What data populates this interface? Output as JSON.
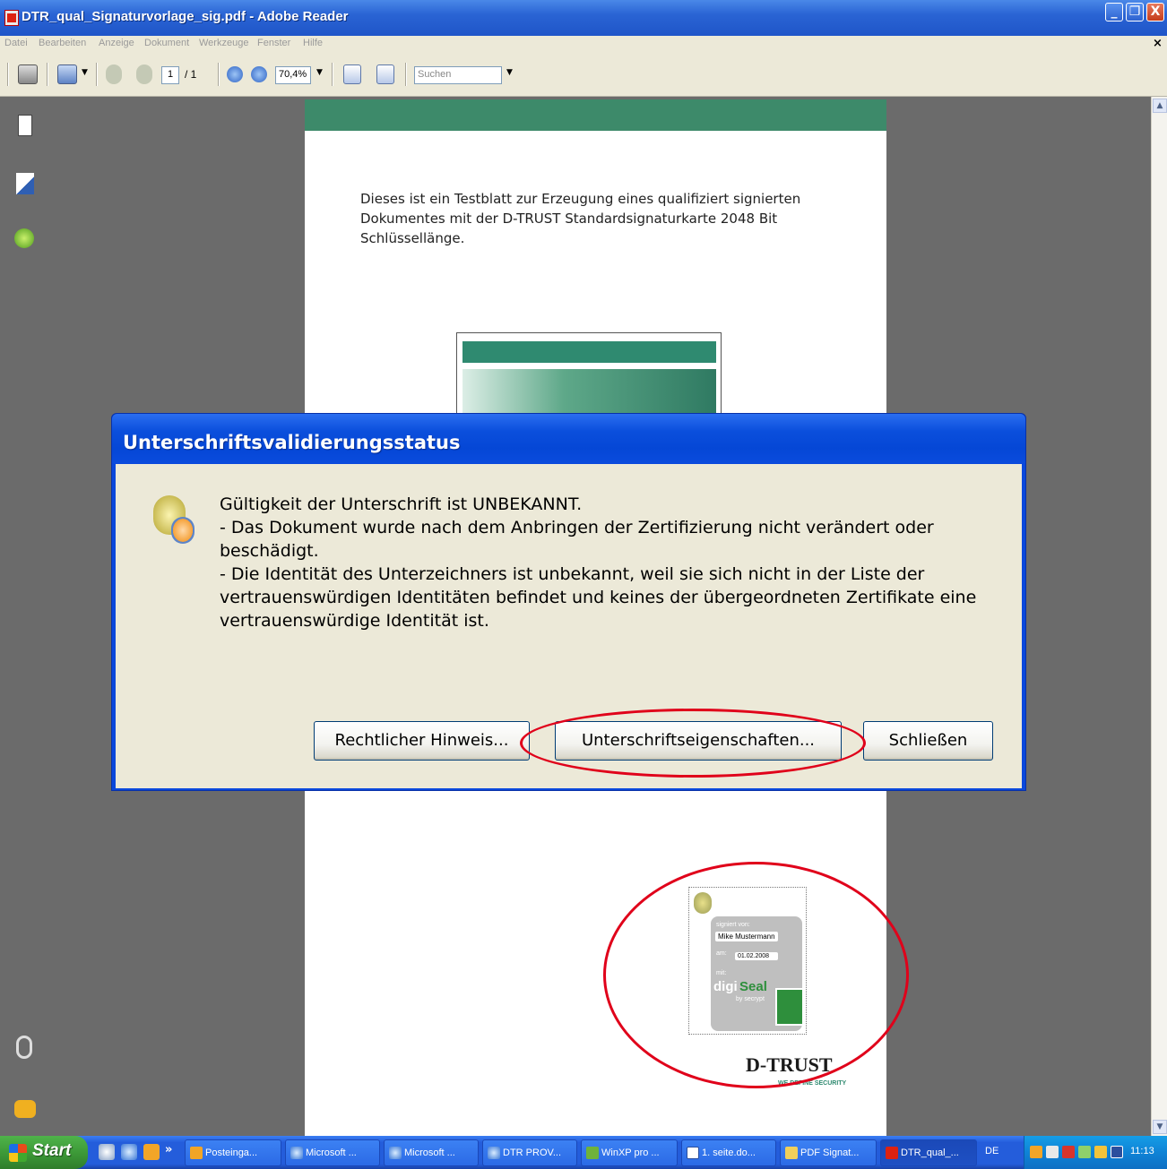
{
  "window": {
    "title": "DTR_qual_Signaturvorlage_sig.pdf - Adobe Reader",
    "minimize": "_",
    "maximize": "❐",
    "close": "X"
  },
  "menubar": {
    "items": [
      "Datei",
      "Bearbeiten",
      "Anzeige",
      "Dokument",
      "Werkzeuge",
      "Fenster",
      "Hilfe"
    ],
    "doc_close": "×"
  },
  "toolbar": {
    "page_current": "1",
    "page_total": "/ 1",
    "zoom": "70,4%",
    "search_placeholder": "Suchen"
  },
  "document": {
    "intro_text": "Dieses ist ein Testblatt zur Erzeugung eines qualifiziert signierten Dokumentes mit der D-TRUST Standardsignaturkarte 2048 Bit Schlüssellänge.",
    "seal": {
      "signed_by_label": "signiert von:",
      "signer": "Mike Mustermann",
      "date_label": "am:",
      "date": "01.02.2008",
      "with_label": "mit:",
      "logo_digi": "digi",
      "logo_seal": "Seal",
      "logo_by": "by secrypt"
    },
    "dtrust_logo": "D-TRUST",
    "dtrust_tagline": "WE DEFINE SECURITY"
  },
  "dialog": {
    "title": "Unterschriftsvalidierungsstatus",
    "message_lines": [
      "Gültigkeit der Unterschrift ist UNBEKANNT.",
      "- Das Dokument wurde nach dem Anbringen der Zertifizierung nicht verändert oder beschädigt.",
      "- Die Identität des Unterzeichners ist unbekannt, weil sie sich nicht in der Liste der vertrauenswürdigen Identitäten befindet und keines der übergeordneten Zertifikate eine vertrauenswürdige Identität ist."
    ],
    "buttons": {
      "legal": "Rechtlicher Hinweis...",
      "properties": "Unterschriftseigenschaften...",
      "close": "Schließen"
    }
  },
  "taskbar": {
    "start": "Start",
    "overflow": "»",
    "buttons": [
      "Posteinga...",
      "Microsoft ...",
      "Microsoft ...",
      "DTR PROV...",
      "WinXP pro ...",
      "1. seite.do...",
      "PDF Signat...",
      "DTR_qual_..."
    ],
    "language": "DE",
    "clock": "11:13"
  },
  "colors": {
    "xp_blue": "#245ddb",
    "annotation_red": "#e0001a",
    "dtrust_green": "#2f8a70"
  }
}
